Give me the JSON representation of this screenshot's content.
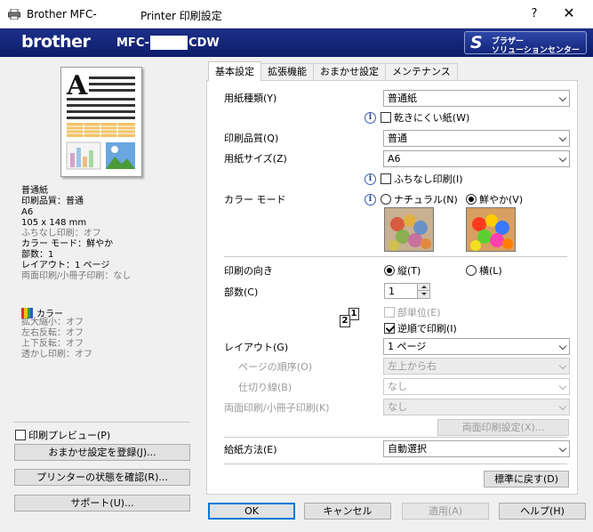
{
  "window": {
    "title_left": "Brother MFC-",
    "title_right": "Printer 印刷設定",
    "help": "?",
    "close": "✕"
  },
  "banner": {
    "logo": "brother",
    "model_prefix": "MFC-",
    "model_suffix": "CDW",
    "solution_line1": "ブラザー",
    "solution_line2": "ソリューションセンター"
  },
  "summary": {
    "lines": [
      {
        "text": "普通紙",
        "dim": false
      },
      {
        "text": "印刷品質：普通",
        "dim": false
      },
      {
        "text": "A6",
        "dim": false
      },
      {
        "text": "105 x 148 mm",
        "dim": false
      },
      {
        "text": "ふちなし印刷：オフ",
        "dim": true
      },
      {
        "text": "カラー モード：鮮やか",
        "dim": false
      },
      {
        "text": "部数：1",
        "dim": false
      },
      {
        "text": "レイアウト：1 ページ",
        "dim": false
      },
      {
        "text": "両面印刷/小冊子印刷：なし",
        "dim": true
      }
    ],
    "color_label": "カラー",
    "color_items": [
      "拡大縮小：オフ",
      "左右反転：オフ",
      "上下反転：オフ",
      "透かし印刷：オフ"
    ]
  },
  "left_controls": {
    "print_preview": "印刷プレビュー(P)",
    "register_button": "おまかせ設定を登録(J)...",
    "status_button": "プリンターの状態を確認(R)...",
    "support_button": "サポート(U)..."
  },
  "tabs": [
    {
      "label": "基本設定",
      "active": true
    },
    {
      "label": "拡張機能",
      "active": false
    },
    {
      "label": "おまかせ設定",
      "active": false
    },
    {
      "label": "メンテナンス",
      "active": false
    }
  ],
  "basic": {
    "media_type_label": "用紙種類(Y)",
    "media_type_value": "普通紙",
    "slow_dry_label": "乾きにくい紙(W)",
    "print_quality_label": "印刷品質(Q)",
    "print_quality_value": "普通",
    "paper_size_label": "用紙サイズ(Z)",
    "paper_size_value": "A6",
    "borderless_label": "ふちなし印刷(I)",
    "color_mode_label": "カラー モード",
    "color_natural": "ナチュラル(N)",
    "color_vivid": "鮮やか(V)",
    "orientation_label": "印刷の向き",
    "portrait": "縦(T)",
    "landscape": "横(L)",
    "copies_label": "部数(C)",
    "copies_value": "1",
    "collate_label": "部単位(E)",
    "reverse_label": "逆順で印刷(I)",
    "layout_label": "レイアウト(G)",
    "layout_value": "1 ページ",
    "page_order_label": "ページの順序(O)",
    "page_order_value": "左上から右",
    "border_line_label": "仕切り線(B)",
    "border_line_value": "なし",
    "duplex_label": "両面印刷/小冊子印刷(K)",
    "duplex_value": "なし",
    "duplex_settings_button": "両面印刷設定(X)...",
    "paper_source_label": "給紙方法(E)",
    "paper_source_value": "自動選択",
    "default_button": "標準に戻す(D)"
  },
  "footer": {
    "ok": "OK",
    "cancel": "キャンセル",
    "apply": "適用(A)",
    "help": "ヘルプ(H)"
  },
  "icons": {
    "info": "i",
    "page_num_front": "2",
    "page_num_back": "1"
  }
}
